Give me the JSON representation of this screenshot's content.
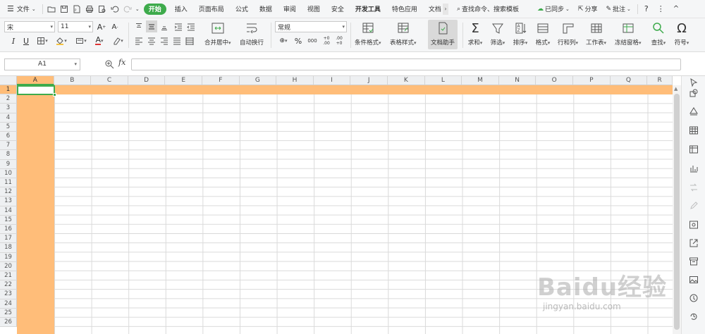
{
  "menubar": {
    "file_menu": "文件",
    "tabs": [
      "开始",
      "插入",
      "页面布局",
      "公式",
      "数据",
      "审阅",
      "视图",
      "安全",
      "开发工具",
      "特色应用",
      "文档"
    ],
    "search_label": "查找命令、搜索模板",
    "sync_label": "已同步",
    "share_label": "分享",
    "comment_label": "批注",
    "help": "?",
    "more": "⋮",
    "collapse": "^"
  },
  "ribbon": {
    "font_name": "宋",
    "font_size": "11",
    "merge_center": "合并居中",
    "wrap_text": "自动换行",
    "number_format": "常规",
    "percent": "%",
    "thousands": "000",
    "dec_inc": "+0 .00",
    "dec_dec": ".00 +0",
    "cond_format": "条件格式",
    "table_style": "表格样式",
    "doc_assistant": "文档助手",
    "sum": "求和",
    "filter": "筛选",
    "sort": "排序",
    "format": "格式",
    "row_col": "行和列",
    "worksheet": "工作表",
    "freeze": "冻结窗格",
    "find": "查找",
    "symbol": "符号"
  },
  "formula_bar": {
    "name_box": "A1",
    "fx": "fx",
    "value": ""
  },
  "sheet": {
    "columns": [
      "A",
      "B",
      "C",
      "D",
      "E",
      "F",
      "G",
      "H",
      "I",
      "J",
      "K",
      "L",
      "M",
      "N",
      "O",
      "P",
      "Q",
      "R"
    ],
    "rows": [
      "1",
      "2",
      "3",
      "4",
      "5",
      "6",
      "7",
      "8",
      "9",
      "10",
      "11",
      "12",
      "13",
      "14",
      "15",
      "16",
      "17",
      "18",
      "19",
      "20",
      "21",
      "22",
      "23",
      "24",
      "25",
      "26"
    ],
    "highlight_color": "#ffbd79",
    "accent_color": "#3eab4c"
  },
  "watermark": {
    "brand": "Baidu经验",
    "url": "jingyan.baidu.com"
  }
}
